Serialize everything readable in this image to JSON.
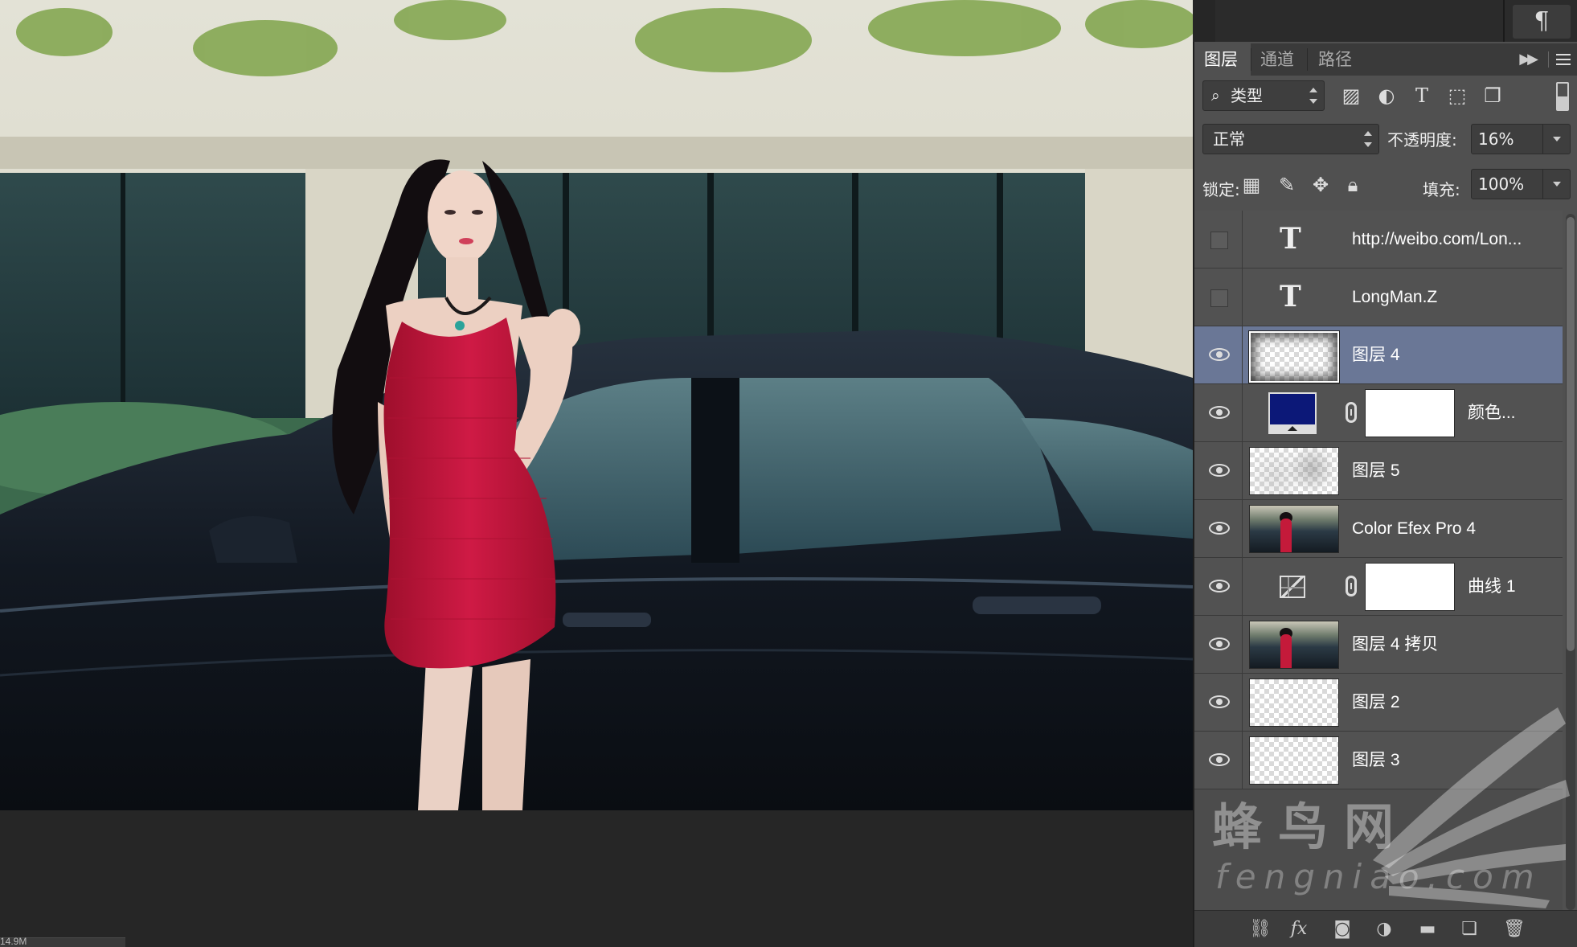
{
  "canvas": {
    "status_text": "14.9M"
  },
  "top": {
    "paragraph_icon": "¶"
  },
  "panel": {
    "tabs": [
      {
        "label": "图层",
        "active": true
      },
      {
        "label": "通道",
        "active": false
      },
      {
        "label": "路径",
        "active": false
      }
    ],
    "filter": {
      "select_label": "类型",
      "icons": [
        "image-filter-icon",
        "adjustment-filter-icon",
        "type-filter-icon",
        "shape-filter-icon",
        "smart-object-filter-icon"
      ]
    },
    "blend_mode": "正常",
    "opacity_label": "不透明度:",
    "opacity_value": "16%",
    "lock_label": "锁定:",
    "lock_icons": [
      "lock-transparent-icon",
      "lock-image-icon",
      "lock-position-icon",
      "lock-all-icon"
    ],
    "fill_label": "填充:",
    "fill_value": "100%",
    "layers": [
      {
        "name": "http://weibo.com/Lon...",
        "kind": "text",
        "visible": false
      },
      {
        "name": "LongMan.Z",
        "kind": "text",
        "visible": false
      },
      {
        "name": "图层 4",
        "kind": "pixel-vignette",
        "visible": true,
        "selected": true
      },
      {
        "name": "颜色...",
        "kind": "fill",
        "visible": true,
        "fill_color": "#0c1878"
      },
      {
        "name": "图层 5",
        "kind": "pixel-blot",
        "visible": true
      },
      {
        "name": "Color Efex Pro 4",
        "kind": "photo",
        "visible": true
      },
      {
        "name": "曲线 1",
        "kind": "curves",
        "visible": true
      },
      {
        "name": "图层 4 拷贝",
        "kind": "photo",
        "visible": true
      },
      {
        "name": "图层 2",
        "kind": "pixel",
        "visible": true
      },
      {
        "name": "图层 3",
        "kind": "pixel",
        "visible": true
      }
    ],
    "bottom_icons": [
      "link-layers-icon",
      "fx-icon",
      "add-mask-icon",
      "adjustment-layer-icon",
      "group-folder-icon",
      "new-layer-icon",
      "trash-icon"
    ],
    "fx_label": "fx"
  },
  "watermark": {
    "text": "蜂鸟网",
    "url": "fengniao.com"
  },
  "colors": {
    "selected_row": "#6a7796",
    "panel_bg": "#505050",
    "dress": "#c41a3a",
    "car": "#151b24"
  }
}
